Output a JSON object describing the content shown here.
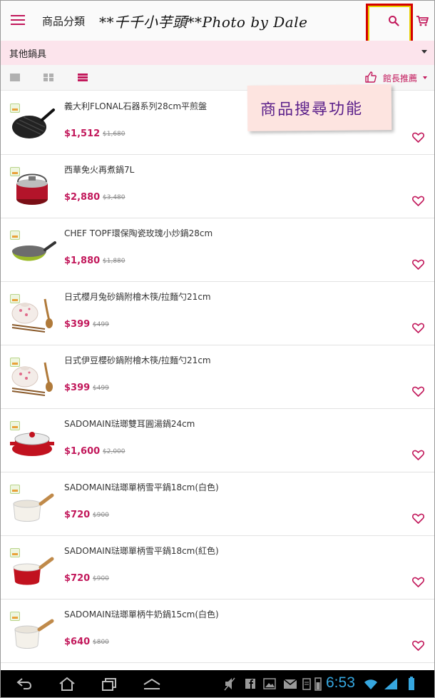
{
  "appbar": {
    "title": "商品分類",
    "watermark": "**千千小芋頭**Photo by Dale",
    "icons": [
      "menu-icon",
      "search-icon",
      "cart-icon"
    ]
  },
  "category": {
    "selected": "其他鍋具"
  },
  "toolbar": {
    "sort_label": "館長推薦",
    "active_view": "list"
  },
  "callout": {
    "text": "商品搜尋功能"
  },
  "colors": {
    "accent": "#c2185b",
    "category_bg": "#fce4ec",
    "highlight_box": "#d40000",
    "clock": "#36a7e0"
  },
  "products": [
    {
      "name": "義大利FLONAL石器系列28cm平煎盤",
      "price": "$1,512",
      "old_price": "$1,680",
      "image": "grill-pan"
    },
    {
      "name": "西華免火再煮鍋7L",
      "price": "$2,880",
      "old_price": "$3,480",
      "image": "red-pot"
    },
    {
      "name": "CHEF TOPF環保陶瓷玫瑰小炒鍋28cm",
      "price": "$1,880",
      "old_price": "$1,880",
      "image": "green-wok"
    },
    {
      "name": "日式櫻月兔砂鍋附檜木筷/拉麵勺21cm",
      "price": "$399",
      "old_price": "$499",
      "image": "clay-pot"
    },
    {
      "name": "日式伊豆櫻砂鍋附檜木筷/拉麵勺21cm",
      "price": "$399",
      "old_price": "$499",
      "image": "clay-pot"
    },
    {
      "name": "SADOMAIN琺瑯雙耳圓湯鍋24cm",
      "price": "$1,600",
      "old_price": "$2,000",
      "image": "red-casserole"
    },
    {
      "name": "SADOMAIN琺瑯單柄雪平鍋18cm(白色)",
      "price": "$720",
      "old_price": "$900",
      "image": "white-saucepan"
    },
    {
      "name": "SADOMAIN琺瑯單柄雪平鍋18cm(紅色)",
      "price": "$720",
      "old_price": "$900",
      "image": "red-saucepan"
    },
    {
      "name": "SADOMAIN琺瑯單柄牛奶鍋15cm(白色)",
      "price": "$640",
      "old_price": "$800",
      "image": "white-milkpan"
    }
  ],
  "statusbar": {
    "time": "6:53"
  }
}
